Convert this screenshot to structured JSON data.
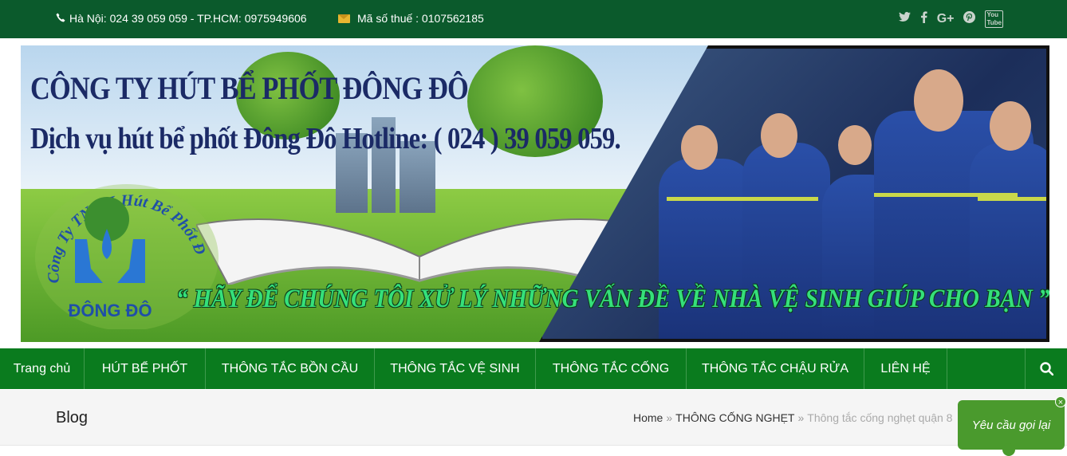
{
  "topbar": {
    "phone_icon": "phone-icon",
    "contact": "Hà Nội: 024 39 059 059 - TP.HCM: 0975949606",
    "envelope_icon": "envelope-icon",
    "tax": "Mã số thuế : 0107562185",
    "social": [
      {
        "icon": "twitter-icon",
        "glyph": "🐦"
      },
      {
        "icon": "facebook-icon",
        "glyph": "f"
      },
      {
        "icon": "google-plus-icon",
        "glyph": "G+"
      },
      {
        "icon": "pinterest-icon",
        "glyph": "℗"
      },
      {
        "icon": "youtube-icon",
        "glyph": "You Tube"
      }
    ]
  },
  "banner": {
    "company_line": "CÔNG TY HÚT BỂ PHỐT ĐÔNG ĐÔ",
    "service_line": "Dịch vụ hút bể phốt Đông Đô Hotline: ( 024 ) 39 059 059.",
    "logo_arc_text": "Công Ty TNHH Hút Bể Phốt Đông Đô",
    "logo_name": "ĐÔNG ĐÔ",
    "slogan": "“ HÃY ĐỂ CHÚNG TÔI XỬ LÝ NHỮNG VẤN ĐỀ VỀ NHÀ VỆ SINH GIÚP CHO BẠN ”"
  },
  "nav": {
    "items": [
      "Trang chủ",
      "HÚT BỂ PHỐT",
      "THÔNG TẮC BỒN CẦU",
      "THÔNG TẮC VỆ SINH",
      "THÔNG TẮC CỐNG",
      "THÔNG TẮC CHẬU RỬA",
      "LIÊN HỆ"
    ],
    "search_icon": "search-icon"
  },
  "page": {
    "title": "Blog",
    "breadcrumb": {
      "home": "Home",
      "sep": "»",
      "category": "THÔNG CỐNG NGHẸT",
      "current": "Thông tắc cống nghẹt quận 8"
    }
  },
  "callback": {
    "label": "Yêu cầu gọi lại",
    "close": "×"
  },
  "colors": {
    "topbar": "#0b5a2c",
    "nav": "#0a7b1e",
    "callback": "#4a9a2d",
    "slogan": "#35e07a"
  }
}
